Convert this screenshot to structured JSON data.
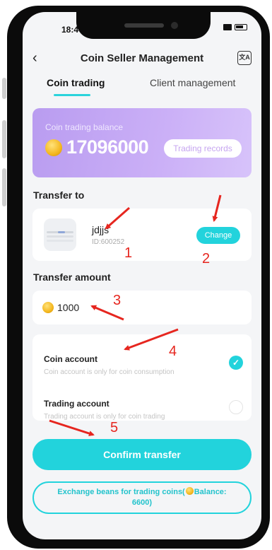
{
  "status_bar": {
    "time": "18:4"
  },
  "header": {
    "title": "Coin Seller Management",
    "back_icon": "chevron-left-icon",
    "translate_icon": "translate-icon"
  },
  "tabs": [
    {
      "label": "Coin trading",
      "active": true
    },
    {
      "label": "Client management",
      "active": false
    }
  ],
  "balance": {
    "label": "Coin trading balance",
    "value": "17096000",
    "records_label": "Trading records"
  },
  "transfer_to": {
    "section_label": "Transfer to",
    "recipient_name": "jdjjs",
    "recipient_id": "ID:600252",
    "change_label": "Change"
  },
  "transfer_amount": {
    "section_label": "Transfer amount",
    "value": "1000"
  },
  "accounts": [
    {
      "title": "Coin account",
      "description": "Coin account is only for coin consumption",
      "selected": true
    },
    {
      "title": "Trading account",
      "description": "Trading account is only for coin trading",
      "selected": false
    }
  ],
  "confirm_label": "Confirm transfer",
  "exchange": {
    "text_before": "Exchange beans for trading coins(",
    "text_after": "Balance: 6600)"
  },
  "annotations": [
    "1",
    "2",
    "3",
    "4",
    "5"
  ],
  "colors": {
    "accent": "#22d3dc",
    "balance_card": "#c1a4f4",
    "annotation": "#e6261f",
    "background": "#f4f5f7"
  }
}
